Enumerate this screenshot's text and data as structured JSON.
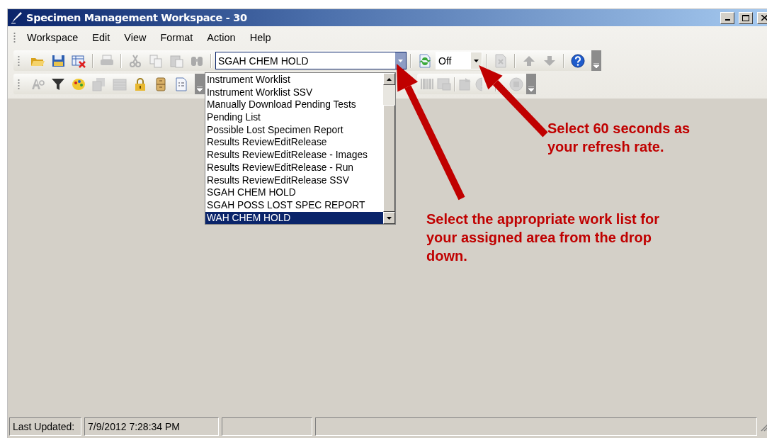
{
  "window": {
    "title": "Specimen Management Workspace - 30"
  },
  "menu": [
    {
      "label": "Workspace"
    },
    {
      "label": "Edit"
    },
    {
      "label": "View"
    },
    {
      "label": "Format"
    },
    {
      "label": "Action"
    },
    {
      "label": "Help"
    }
  ],
  "toolbar_1": [
    {
      "kind": "open",
      "disabled": false
    },
    {
      "kind": "save",
      "disabled": false
    },
    {
      "kind": "delete",
      "disabled": false
    },
    {
      "kind": "sep"
    },
    {
      "kind": "print",
      "disabled": true
    },
    {
      "kind": "sep"
    },
    {
      "kind": "cut",
      "disabled": true
    },
    {
      "kind": "copy",
      "disabled": true
    },
    {
      "kind": "paste",
      "disabled": true
    },
    {
      "kind": "find",
      "disabled": true
    },
    {
      "kind": "sep"
    },
    {
      "kind": "worklist-combo",
      "value": "SGAH CHEM HOLD",
      "expanded": true
    },
    {
      "kind": "sep"
    },
    {
      "kind": "refresh",
      "disabled": false
    },
    {
      "kind": "refresh-combo",
      "value": "Off",
      "expanded": false
    },
    {
      "kind": "sep"
    },
    {
      "kind": "remove",
      "disabled": true
    },
    {
      "kind": "sep"
    },
    {
      "kind": "up",
      "disabled": true
    },
    {
      "kind": "down",
      "disabled": true
    },
    {
      "kind": "sep"
    },
    {
      "kind": "help",
      "disabled": false
    }
  ],
  "toolbar_2": [
    {
      "kind": "font",
      "disabled": true
    },
    {
      "kind": "filter",
      "disabled": false
    },
    {
      "kind": "palette",
      "disabled": false
    },
    {
      "kind": "table",
      "disabled": true
    },
    {
      "kind": "panel",
      "disabled": true
    },
    {
      "kind": "lock",
      "disabled": false
    },
    {
      "kind": "cabinet",
      "disabled": false
    },
    {
      "kind": "document",
      "disabled": false
    }
  ],
  "toolbar_3": [
    {
      "kind": "barcode",
      "disabled": true
    },
    {
      "kind": "form",
      "disabled": true
    },
    {
      "kind": "sep"
    },
    {
      "kind": "report",
      "disabled": true
    },
    {
      "kind": "alert",
      "disabled": true
    },
    {
      "kind": "sep"
    },
    {
      "kind": "stop",
      "disabled": true
    }
  ],
  "worklist_dropdown": {
    "items": [
      {
        "label": "Instrument Worklist",
        "selected": false
      },
      {
        "label": "Instrument Worklist SSV",
        "selected": false
      },
      {
        "label": "Manually Download Pending Tests",
        "selected": false
      },
      {
        "label": "Pending List",
        "selected": false
      },
      {
        "label": "Possible Lost Specimen Report",
        "selected": false
      },
      {
        "label": "Results ReviewEditRelease",
        "selected": false
      },
      {
        "label": "Results ReviewEditRelease - Images",
        "selected": false
      },
      {
        "label": "Results ReviewEditRelease - Run",
        "selected": false
      },
      {
        "label": "Results ReviewEditRelease SSV",
        "selected": false
      },
      {
        "label": "SGAH CHEM HOLD",
        "selected": false
      },
      {
        "label": "SGAH POSS LOST SPEC REPORT",
        "selected": false
      },
      {
        "label": "WAH CHEM HOLD",
        "selected": true
      }
    ]
  },
  "status_bar": {
    "fields": [
      "Last Updated:",
      "7/9/2012  7:28:34 PM"
    ]
  },
  "annotations": [
    {
      "text": "Select 60 seconds as your refresh rate."
    },
    {
      "text": "Select the appropriate work list for your assigned area from the drop down."
    }
  ]
}
